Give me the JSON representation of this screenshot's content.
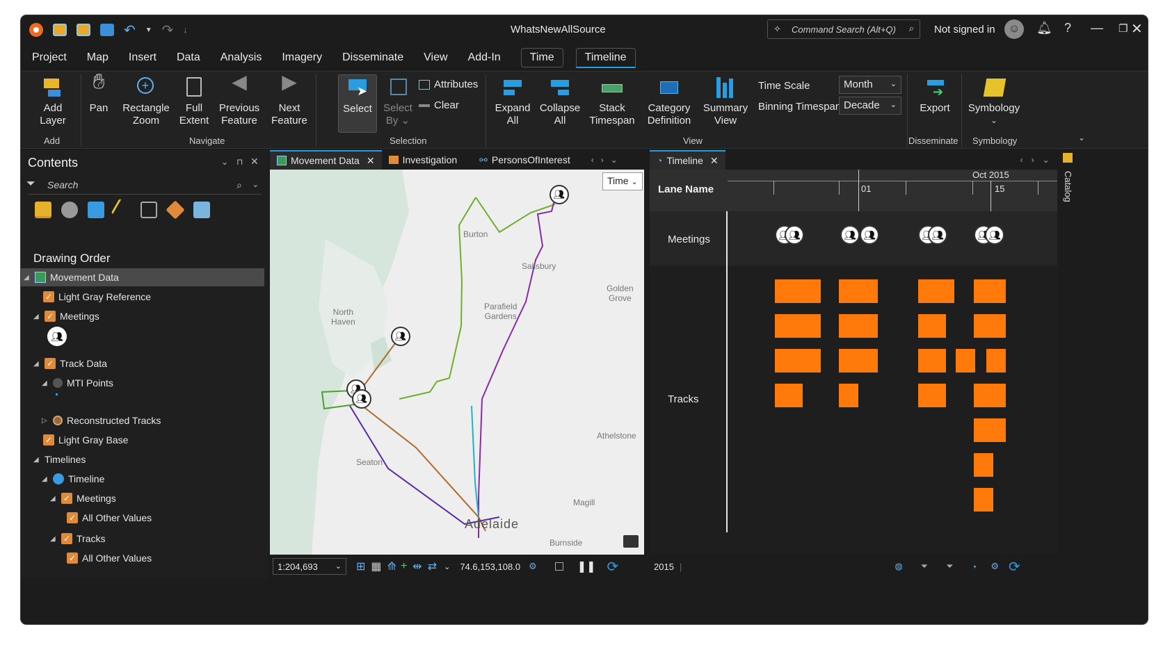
{
  "app": {
    "title": "WhatsNewAllSource",
    "command_search": "Command Search (Alt+Q)",
    "signin": "Not signed in"
  },
  "menu": [
    "Project",
    "Map",
    "Insert",
    "Data",
    "Analysis",
    "Imagery",
    "Disseminate",
    "View",
    "Add-In",
    "Time",
    "Timeline"
  ],
  "ribbon": {
    "add_layer": [
      "Add",
      "Layer"
    ],
    "pan": "Pan",
    "rect_zoom": [
      "Rectangle",
      "Zoom"
    ],
    "full_extent": [
      "Full",
      "Extent"
    ],
    "prev_feature": [
      "Previous",
      "Feature"
    ],
    "next_feature": [
      "Next",
      "Feature"
    ],
    "select": "Select",
    "select_by": [
      "Select",
      "By"
    ],
    "attributes": "Attributes",
    "clear": "Clear",
    "expand_all": [
      "Expand",
      "All"
    ],
    "collapse_all": [
      "Collapse",
      "All"
    ],
    "stack_timespan": [
      "Stack",
      "Timespan"
    ],
    "category_def": [
      "Category",
      "Definition"
    ],
    "summary_view": [
      "Summary",
      "View"
    ],
    "time_scale_label": "Time Scale",
    "time_scale_value": "Month",
    "binning_label": "Binning Timespan",
    "binning_value": "Decade",
    "export": "Export",
    "symbology": "Symbology",
    "groups": {
      "add": "Add",
      "navigate": "Navigate",
      "selection": "Selection",
      "view": "View",
      "disseminate": "Disseminate",
      "symbology": "Symbology"
    }
  },
  "contents": {
    "title": "Contents",
    "search_placeholder": "Search",
    "drawing_order": "Drawing Order",
    "items": {
      "movement_data": "Movement Data",
      "light_gray_ref": "Light Gray Reference",
      "meetings": "Meetings",
      "track_data": "Track Data",
      "mti_points": "MTI Points",
      "reconstructed_tracks": "Reconstructed Tracks",
      "light_gray_base": "Light Gray Base",
      "timelines": "Timelines",
      "timeline": "Timeline",
      "tl_meetings": "Meetings",
      "tl_meetings_all": "All Other Values",
      "tl_tracks": "Tracks",
      "tl_tracks_all": "All Other Values"
    }
  },
  "tabs": {
    "movement_data": "Movement Data",
    "investigation": "Investigation",
    "persons": "PersonsOfInterest",
    "timeline": "Timeline"
  },
  "map": {
    "time_btn": "Time",
    "labels": {
      "burton": "Burton",
      "salisbury": "Salisbury",
      "golden_grove": "Golden\nGrove",
      "north_haven": "North\nHaven",
      "parafield": "Parafield\nGardens",
      "seaton": "Seaton",
      "athelstone": "Athelstone",
      "magill": "Magill",
      "adelaide": "Adelaide",
      "burnside": "Burnside"
    },
    "scale": "1:204,693",
    "coords": "74.6,153,108.0"
  },
  "timeline": {
    "lane_header": "Lane Name",
    "month": "Oct 2015",
    "tick_01": "01",
    "tick_15": "15",
    "lanes": {
      "meetings": "Meetings",
      "tracks": "Tracks"
    },
    "year": "2015"
  },
  "catalog": "Catalog",
  "colors": {
    "accent": "#2a9de0",
    "bar": "#ff7a0a",
    "check": "#e08a3a"
  }
}
